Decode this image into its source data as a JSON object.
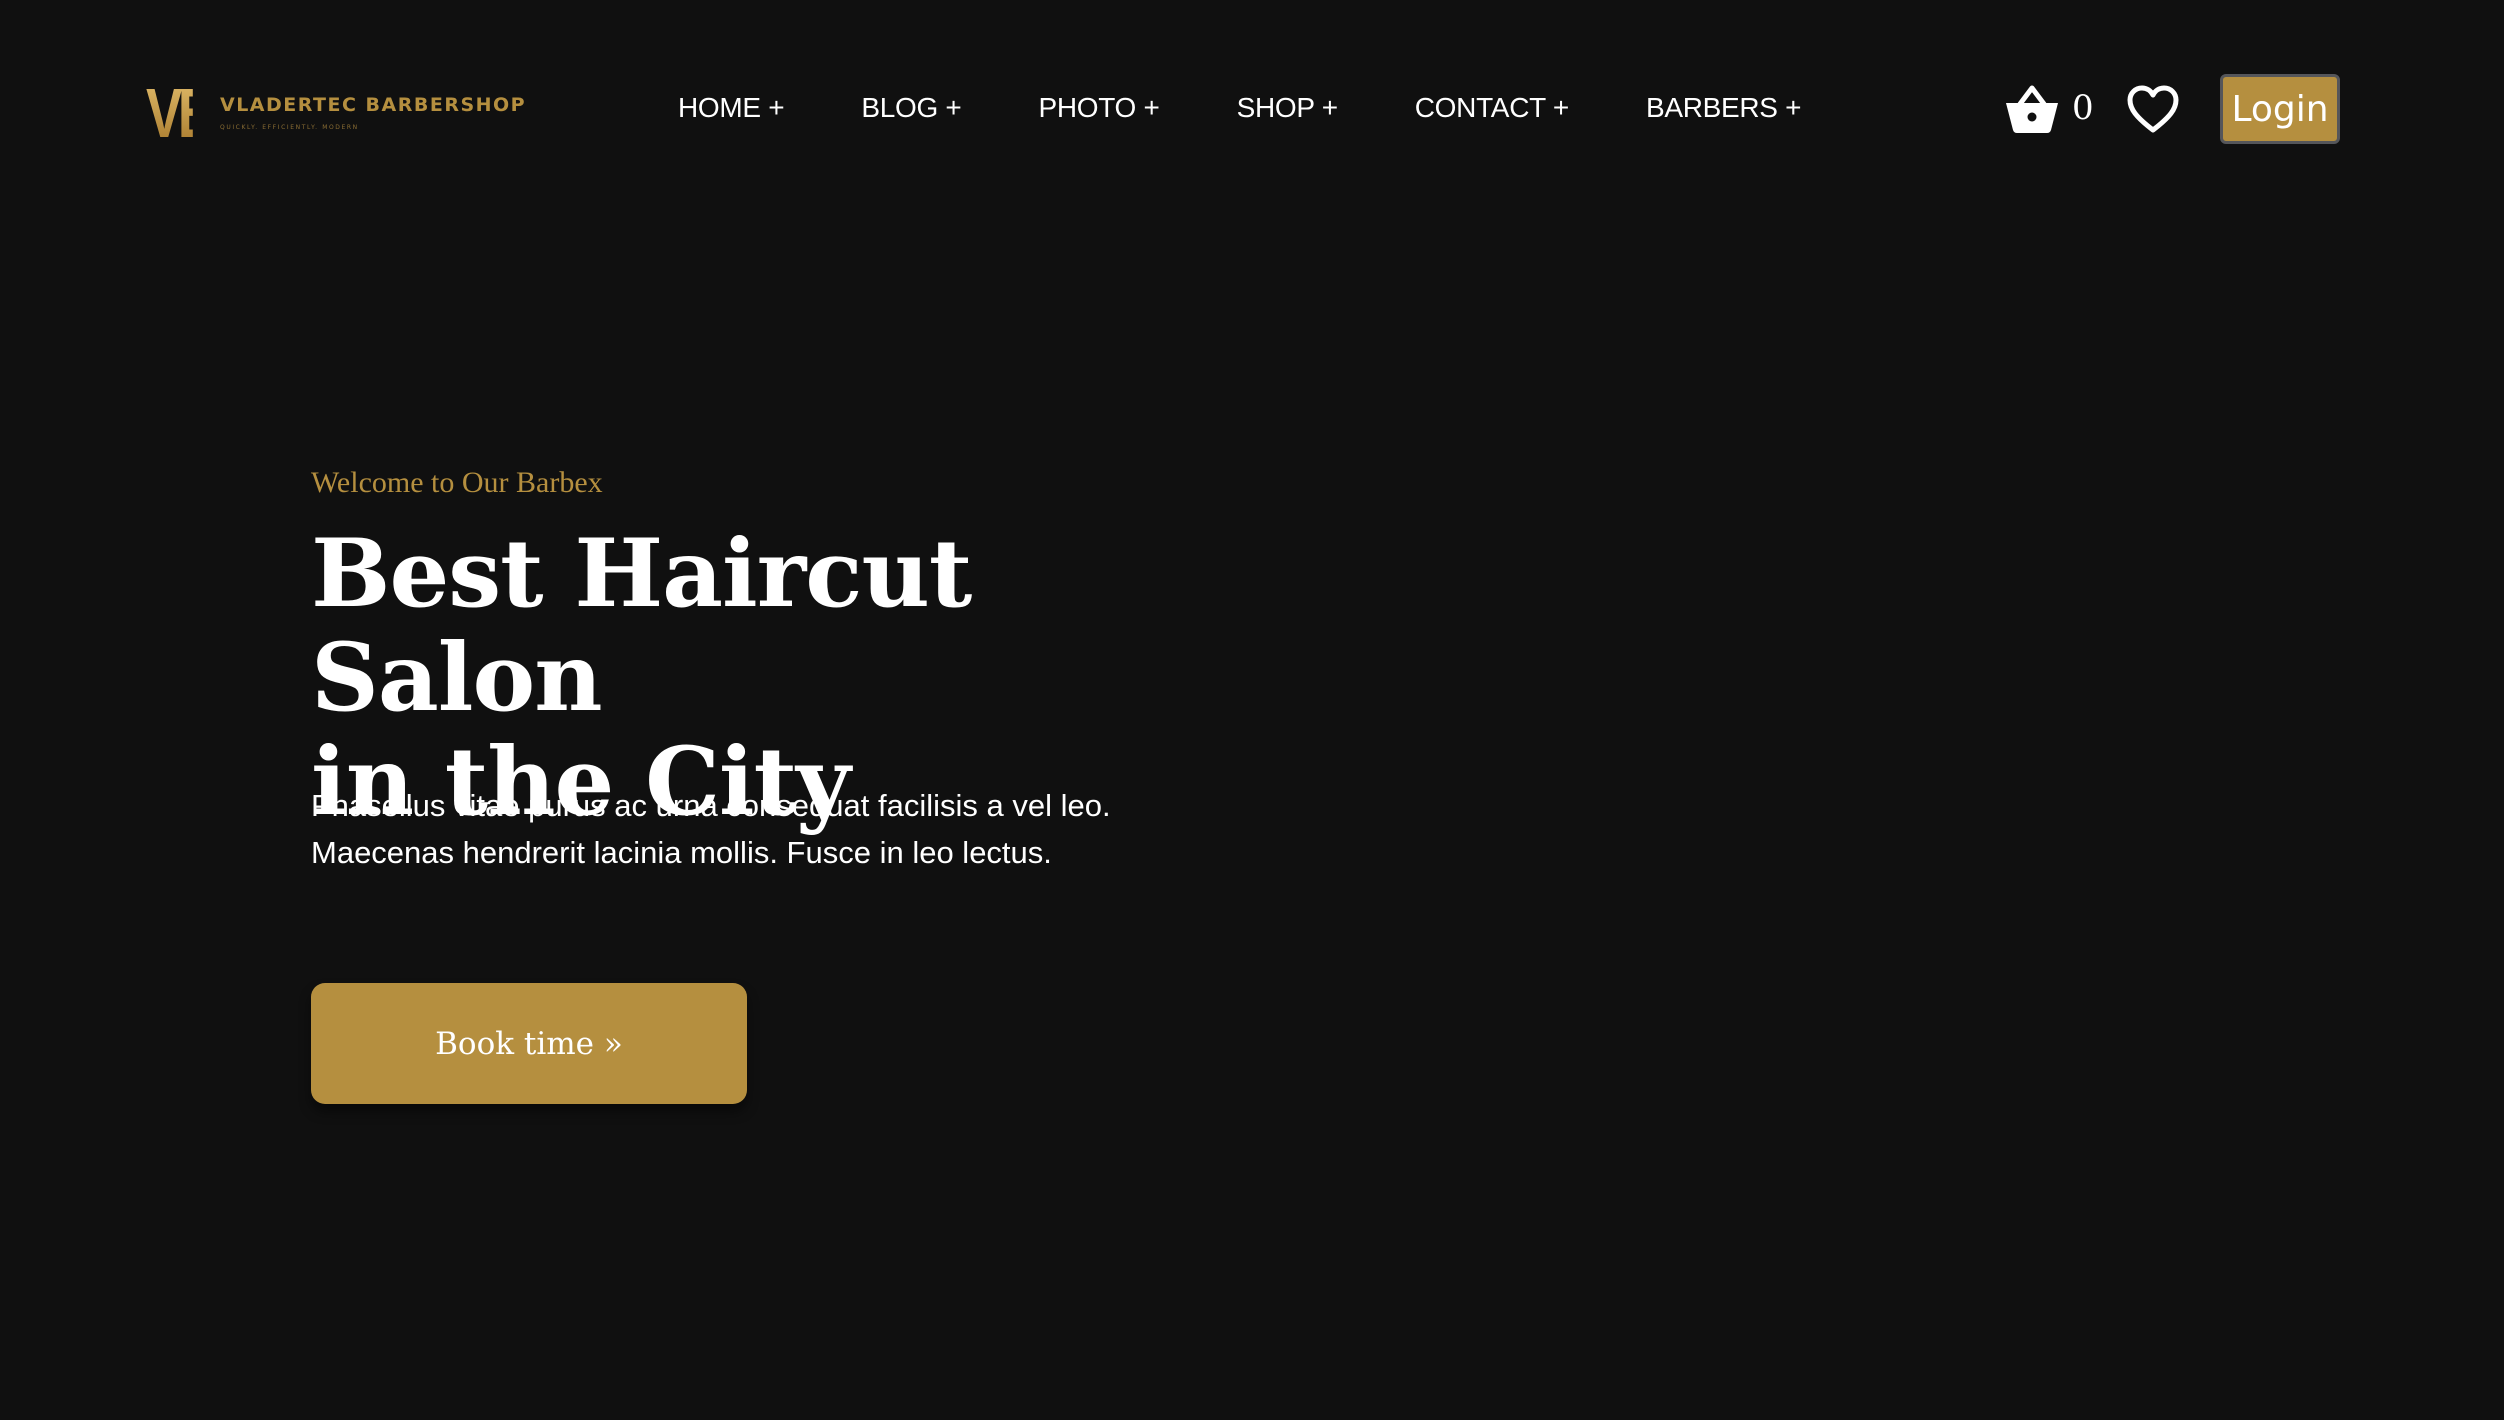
{
  "brand": {
    "mark": "VB",
    "name": "VLADERTEC BARBERSHOP",
    "tagline": "QUICKLY. EFFICIENTLY. MODERN"
  },
  "nav": {
    "items": [
      {
        "label": "HOME +"
      },
      {
        "label": "BLOG +"
      },
      {
        "label": "PHOTO +"
      },
      {
        "label": "SHOP +"
      },
      {
        "label": "CONTACT +"
      },
      {
        "label": "BARBERS +"
      }
    ]
  },
  "header_actions": {
    "cart_count": "0",
    "cart_icon": "basket-icon",
    "wishlist_icon": "heart-icon",
    "login_label": "Login"
  },
  "hero": {
    "kicker": "Welcome to Our Barbex",
    "title_line1": "Best Haircut Salon",
    "title_line2": "in the City",
    "description_line1": "Phasellus vitae purus ac urna consequat facilisis a vel leo.",
    "description_line2": "Maecenas hendrerit lacinia mollis. Fusce in leo lectus.",
    "cta_label": "Book time »"
  },
  "colors": {
    "background": "#101010",
    "accent": "#b58f3f",
    "text": "#ffffff"
  }
}
